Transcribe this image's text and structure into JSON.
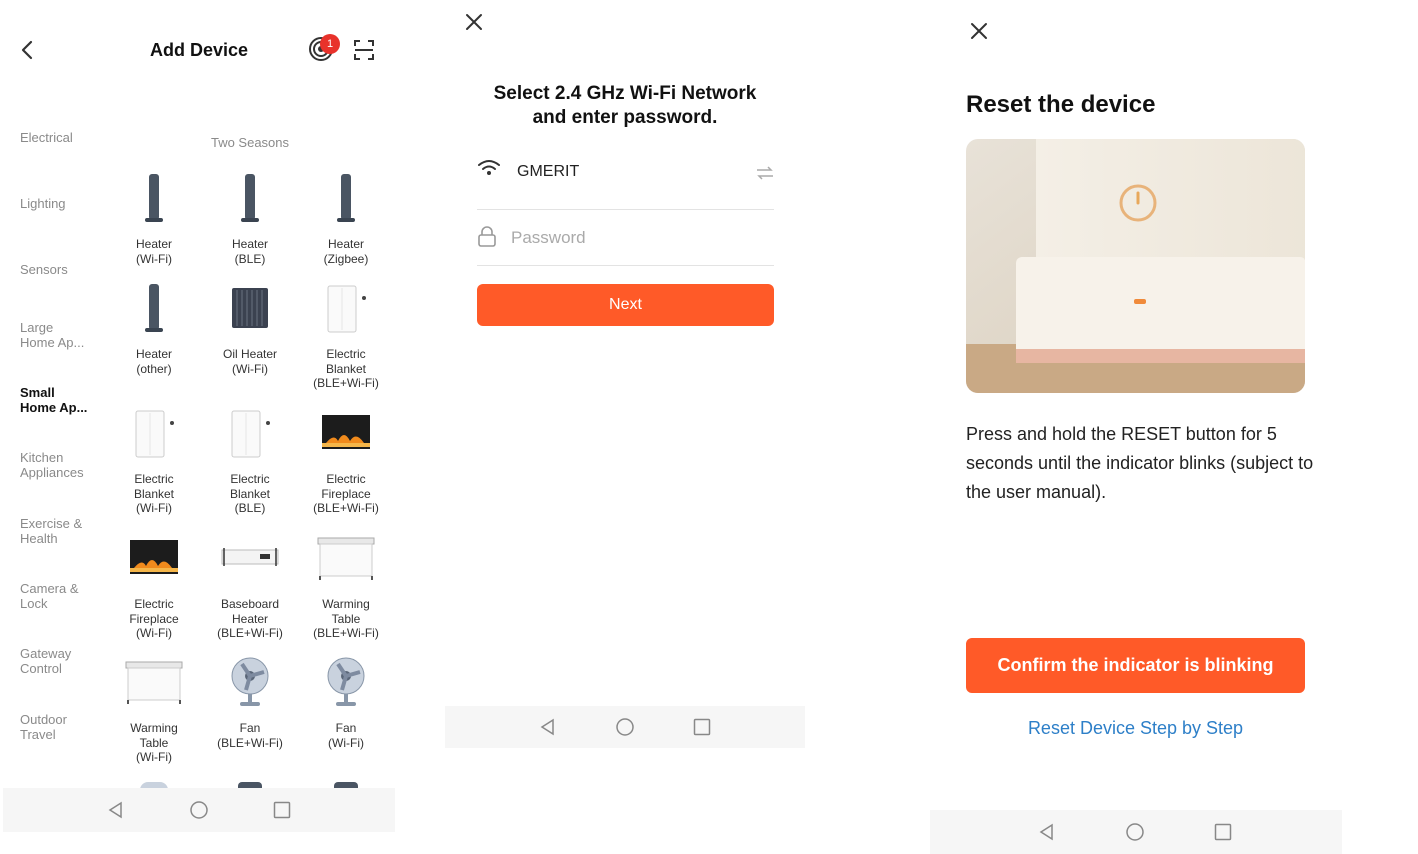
{
  "screen1": {
    "title": "Add Device",
    "badge_count": "1",
    "categories": [
      {
        "label": "Electrical"
      },
      {
        "label": "Lighting"
      },
      {
        "label": "Sensors"
      },
      {
        "label": "Large Home Ap..."
      },
      {
        "label": "Small Home Ap..."
      },
      {
        "label": "Kitchen Appliances"
      },
      {
        "label": "Exercise & Health"
      },
      {
        "label": "Camera & Lock"
      },
      {
        "label": "Gateway Control"
      },
      {
        "label": "Outdoor Travel"
      }
    ],
    "active_category": "Small Home Ap...",
    "section_title": "Two Seasons",
    "devices": [
      {
        "name": "Heater\n(Wi-Fi)",
        "icon": "tower-heater-icon"
      },
      {
        "name": "Heater\n(BLE)",
        "icon": "tower-heater-icon"
      },
      {
        "name": "Heater\n(Zigbee)",
        "icon": "tower-heater-icon"
      },
      {
        "name": "Heater\n(other)",
        "icon": "tower-heater-icon"
      },
      {
        "name": "Oil Heater\n(Wi-Fi)",
        "icon": "oil-heater-icon"
      },
      {
        "name": "Electric\nBlanket\n(BLE+Wi-Fi)",
        "icon": "electric-blanket-icon"
      },
      {
        "name": "Electric\nBlanket\n(Wi-Fi)",
        "icon": "electric-blanket-icon"
      },
      {
        "name": "Electric\nBlanket\n(BLE)",
        "icon": "electric-blanket-icon"
      },
      {
        "name": "Electric\nFireplace\n(BLE+Wi-Fi)",
        "icon": "electric-fireplace-icon"
      },
      {
        "name": "Electric\nFireplace\n(Wi-Fi)",
        "icon": "electric-fireplace-icon"
      },
      {
        "name": "Baseboard\nHeater\n(BLE+Wi-Fi)",
        "icon": "baseboard-heater-icon"
      },
      {
        "name": "Warming\nTable\n(BLE+Wi-Fi)",
        "icon": "warming-table-icon"
      },
      {
        "name": "Warming\nTable\n(Wi-Fi)",
        "icon": "warming-table-icon"
      },
      {
        "name": "Fan\n(BLE+Wi-Fi)",
        "icon": "desk-fan-icon"
      },
      {
        "name": "Fan\n(Wi-Fi)",
        "icon": "desk-fan-icon"
      }
    ]
  },
  "screen2": {
    "heading": "Select 2.4 GHz Wi-Fi Network and enter password.",
    "ssid": "GMERIT",
    "password_placeholder": "Password",
    "next_label": "Next"
  },
  "screen3": {
    "title": "Reset the device",
    "description": "Press and hold the RESET button for 5 seconds until the indicator blinks (subject to the user manual).",
    "confirm_label": "Confirm the indicator is blinking",
    "step_link": "Reset Device Step by Step"
  },
  "colors": {
    "accent": "#ff5a28",
    "link": "#2d7fc8",
    "badge": "#e8322b",
    "muted": "#8a8a8a"
  }
}
